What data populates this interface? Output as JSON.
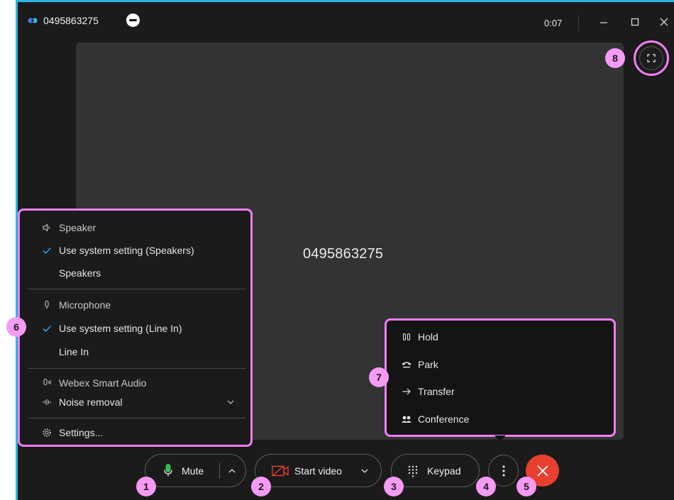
{
  "window": {
    "title": "0495863275",
    "timer": "0:07"
  },
  "call": {
    "caller_number": "0495863275"
  },
  "audio_menu": {
    "speaker_heading": "Speaker",
    "speaker_system_option": "Use system setting (Speakers)",
    "speaker_device_option": "Speakers",
    "microphone_heading": "Microphone",
    "microphone_system_option": "Use system setting (Line In)",
    "microphone_device_option": "Line In",
    "smart_audio_label": "Webex Smart Audio",
    "noise_removal_label": "Noise removal",
    "settings_label": "Settings..."
  },
  "call_menu": {
    "hold_label": "Hold",
    "park_label": "Park",
    "transfer_label": "Transfer",
    "conference_label": "Conference"
  },
  "controls": {
    "mute_label": "Mute",
    "start_video_label": "Start video",
    "keypad_label": "Keypad"
  },
  "badges": {
    "mute": "1",
    "video": "2",
    "keypad": "3",
    "more": "4",
    "end": "5",
    "audio_menu": "6",
    "call_menu": "7",
    "fullscreen": "8"
  },
  "colors": {
    "highlight": "#f27df3",
    "badge": "#f59af5",
    "end_call": "#e8402f",
    "frame_accent": "#2bb6e3",
    "background": "#1b1b1b",
    "stage": "#333333"
  }
}
